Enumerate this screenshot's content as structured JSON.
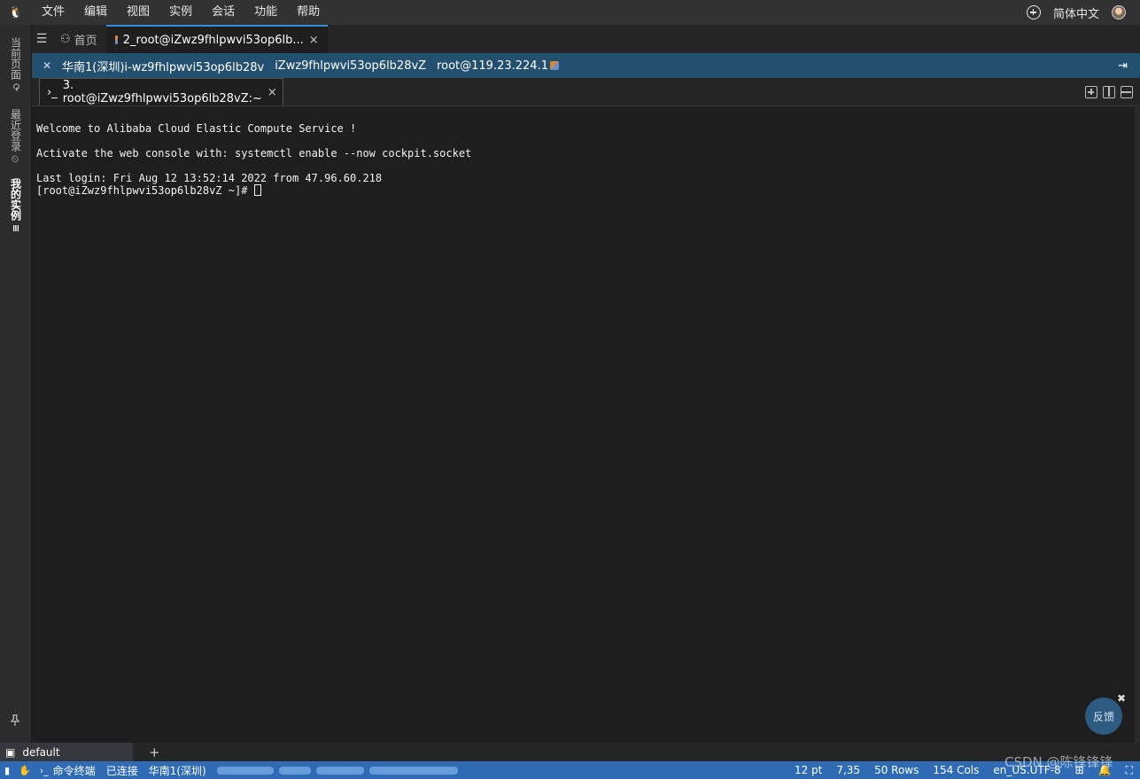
{
  "menubar": {
    "logo": "🐧",
    "items": [
      "文件",
      "编辑",
      "视图",
      "实例",
      "会话",
      "功能",
      "帮助"
    ],
    "language": "简体中文"
  },
  "leftbar": {
    "tabs": [
      {
        "label": "当前页面",
        "icon": "⟳"
      },
      {
        "label": "最近登录",
        "icon": "⏲"
      },
      {
        "label": "我的实例",
        "icon": "≡"
      }
    ]
  },
  "tabbar": {
    "home_label": "首页",
    "session_label": "2_root@iZwz9fhlpwvi53op6lb...",
    "close": "×"
  },
  "infobar": {
    "region": "华南1(深圳)i-wz9fhlpwvi53op6lb28v",
    "hostname": "iZwz9fhlpwvi53op6lb28vZ",
    "login": "root@119.23.224.1"
  },
  "terminal_tab": {
    "prompt_icon": "›_",
    "label": "3. root@iZwz9fhlpwvi53op6lb28vZ:~",
    "close": "×"
  },
  "terminal": {
    "lines": [
      "Welcome to Alibaba Cloud Elastic Compute Service !",
      "",
      "Activate the web console with: systemctl enable --now cockpit.socket",
      "",
      "Last login: Fri Aug 12 13:52:14 2022 from 47.96.60.218"
    ],
    "prompt": "[root@iZwz9fhlpwvi53op6lb28vZ ~]# "
  },
  "feedback": {
    "label": "反馈",
    "close": "✖"
  },
  "sessionbar": {
    "default_label": "default",
    "add": "+"
  },
  "statusbar": {
    "terminal_label": "命令终端",
    "connection": "已连接",
    "region": "华南1(深圳)",
    "font_size": "12 pt",
    "cursor_pos": "7,35",
    "rows": "50 Rows",
    "cols": "154 Cols",
    "encoding": "en_US.UTF-8"
  },
  "watermark": "CSDN @陈锋锋锋",
  "colors": {
    "accent": "#2e6bb4",
    "infobar": "#24506f",
    "terminal_bg": "#1e1e1e"
  }
}
